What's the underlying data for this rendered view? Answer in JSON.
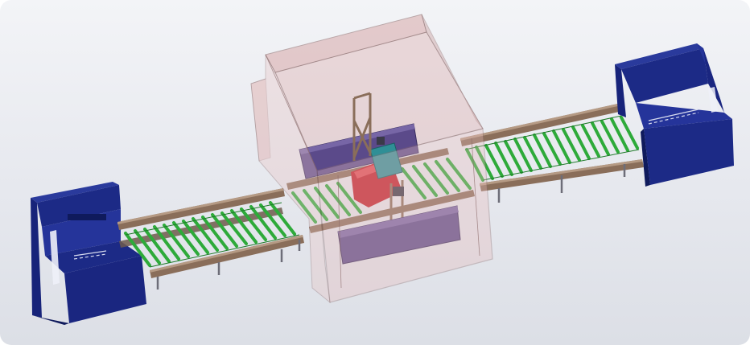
{
  "scene": {
    "type": "cad-3d-viewport",
    "components": [
      "left-loading-frame",
      "left-roller-conveyor",
      "transparent-enclosure",
      "gantry-machine",
      "right-roller-conveyor",
      "right-loading-frame"
    ]
  },
  "colors": {
    "background_top": "#f3f4f7",
    "background_bottom": "#dcdfe6",
    "frame_blue": "#1c2a86",
    "frame_blue_dark": "#0f1a5c",
    "roller_green": "#2eaa3a",
    "rail_brown": "#8a6e5a",
    "enclosure_fill": "#d8a9a9",
    "enclosure_edge": "#8c6a6a",
    "machine_purple": "#5b4a8a",
    "machine_red": "#c21f2a",
    "teal_part": "#2f8f96"
  }
}
